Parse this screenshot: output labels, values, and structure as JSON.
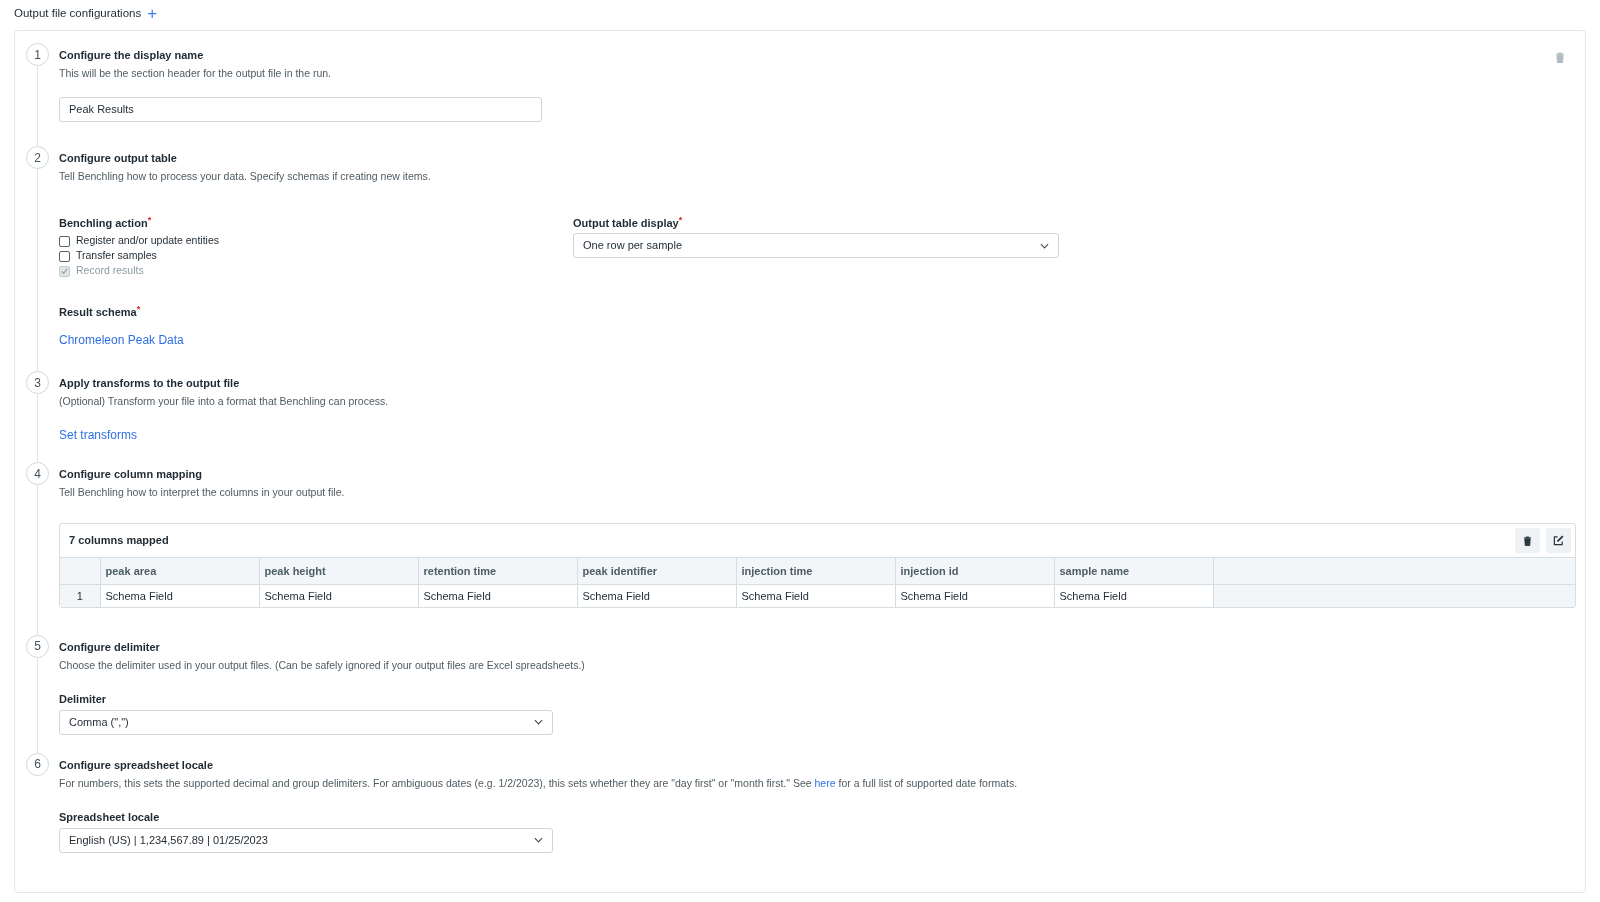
{
  "header": {
    "title": "Output file configurations",
    "add_icon": "+"
  },
  "steps": [
    {
      "number": "1",
      "title": "Configure the display name",
      "description": "This will be the section header for the output file in the run.",
      "blocks": [
        {
          "kind": "input",
          "value": "Peak Results"
        }
      ]
    },
    {
      "number": "2",
      "title": "Configure output table",
      "description": "Tell Benchling how to process your data. Specify schemas if creating new items.",
      "blocks": [
        {
          "kind": "action_columns",
          "checklist": {
            "label": "Benchling action",
            "required_mark": "*",
            "options": [
              {
                "label": "Register and/or update entities",
                "checked": false,
                "disabled": false
              },
              {
                "label": "Transfer samples",
                "checked": false,
                "disabled": false
              },
              {
                "label": "Record results",
                "checked": true,
                "disabled": true
              }
            ]
          },
          "dropdown": {
            "label": "Output table display",
            "required_mark": "*",
            "value": "One row per sample"
          }
        },
        {
          "kind": "link_field",
          "label": "Result schema",
          "required_mark": "*",
          "link": "Chromeleon Peak Data"
        }
      ]
    },
    {
      "number": "3",
      "title": "Apply transforms to the output file",
      "description": "(Optional) Transform your file into a format that Benchling can process.",
      "blocks": [
        {
          "kind": "link",
          "text": "Set transforms"
        }
      ]
    },
    {
      "number": "4",
      "title": "Configure column mapping",
      "description": "Tell Benchling how to interpret the columns in your output file.",
      "blocks": [
        {
          "kind": "table",
          "caption": "7 columns mapped",
          "columns": [
            "peak area",
            "peak height",
            "retention time",
            "peak identifier",
            "injection time",
            "injection id",
            "sample name"
          ],
          "rows": [
            {
              "index": "1",
              "cells": [
                "Schema Field",
                "Schema Field",
                "Schema Field",
                "Schema Field",
                "Schema Field",
                "Schema Field",
                "Schema Field"
              ]
            }
          ]
        }
      ]
    },
    {
      "number": "5",
      "title": "Configure delimiter",
      "description": "Choose the delimiter used in your output files. (Can be safely ignored if your output files are Excel spreadsheets.)",
      "blocks": [
        {
          "kind": "select",
          "label": "Delimiter",
          "value": "Comma (\",\")"
        }
      ]
    },
    {
      "number": "6",
      "title": "Configure spreadsheet locale",
      "description": "For numbers, this sets the supported decimal and group delimiters. For ambiguous dates (e.g. 1/2/2023), this sets whether they are \"day first\" or \"month first.\" See ",
      "description_link": "here",
      "description_end": " for a full list of supported date formats.",
      "blocks": [
        {
          "kind": "select",
          "label": "Spreadsheet locale",
          "value": "English (US) | 1,234,567.89 | 01/25/2023"
        }
      ]
    }
  ]
}
